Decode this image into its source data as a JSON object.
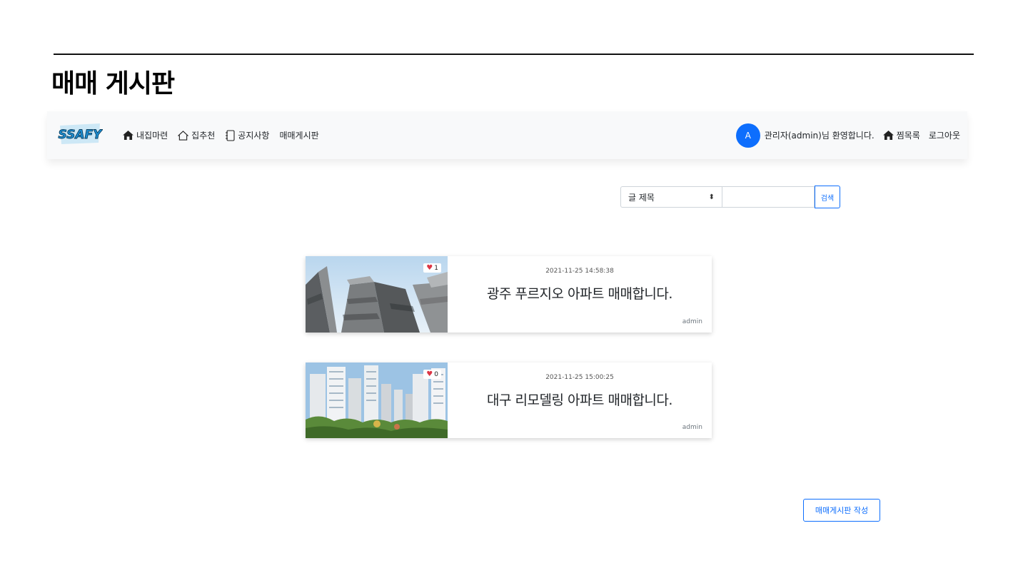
{
  "page": {
    "title": "매매 게시판"
  },
  "nav": {
    "logo_text": "SSAFY",
    "items": [
      {
        "label": "내집마련",
        "icon": "house-fill-icon"
      },
      {
        "label": "집추천",
        "icon": "house-outline-icon"
      },
      {
        "label": "공지사항",
        "icon": "notebook-icon"
      },
      {
        "label": "매매게시판",
        "icon": ""
      }
    ],
    "avatar_letter": "A",
    "welcome": "관리자(admin)님 환영합니다.",
    "favorites": "찜목록",
    "logout": "로그아웃"
  },
  "search": {
    "select_value": "글 제목",
    "input_value": "",
    "button_label": "검색"
  },
  "posts": [
    {
      "date": "2021-11-25 14:58:38",
      "title": "광주 푸르지오 아파트 매매합니다.",
      "author": "admin",
      "likes": "1"
    },
    {
      "date": "2021-11-25 15:00:25",
      "title": "대구 리모델링 아파트 매매합니다.",
      "author": "admin",
      "likes": "0"
    }
  ],
  "write_button": "매매게시판 작성",
  "colors": {
    "accent": "#0d6efd",
    "heart": "#dc3545",
    "navbar_bg": "#f8f9fa"
  }
}
